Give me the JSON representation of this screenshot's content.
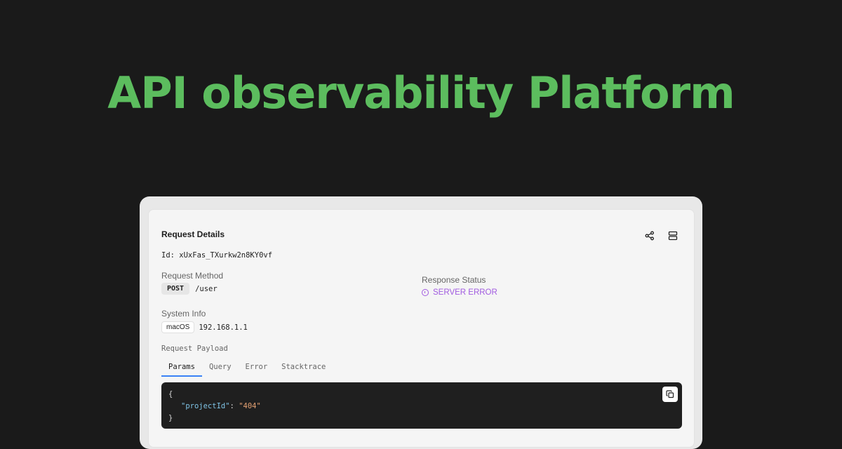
{
  "hero": {
    "title": "API observability Platform"
  },
  "card": {
    "title": "Request Details",
    "id_text": "Id: xUxFas_TXurkw2n8KY0vf",
    "request_method": {
      "label": "Request Method",
      "method": "POST",
      "path": "/user"
    },
    "response_status": {
      "label": "Response Status",
      "value": "SERVER ERROR"
    },
    "system_info": {
      "label": "System Info",
      "os": "macOS",
      "ip": "192.168.1.1"
    },
    "payload": {
      "label": "Request Payload",
      "tabs": [
        {
          "label": "Params",
          "active": true
        },
        {
          "label": "Query",
          "active": false
        },
        {
          "label": "Error",
          "active": false
        },
        {
          "label": "Stacktrace",
          "active": false
        }
      ],
      "code": {
        "open": "{",
        "key": "\"projectId\"",
        "colon": ": ",
        "value": "\"404\"",
        "close": "}"
      }
    }
  },
  "colors": {
    "background": "#1a1a1a",
    "hero": "#5cbd5e",
    "status_error": "#a15be0",
    "tab_active": "#3b82f6"
  },
  "icons": [
    "share-icon",
    "layout-rows-icon",
    "alert-circle-icon",
    "copy-icon"
  ]
}
